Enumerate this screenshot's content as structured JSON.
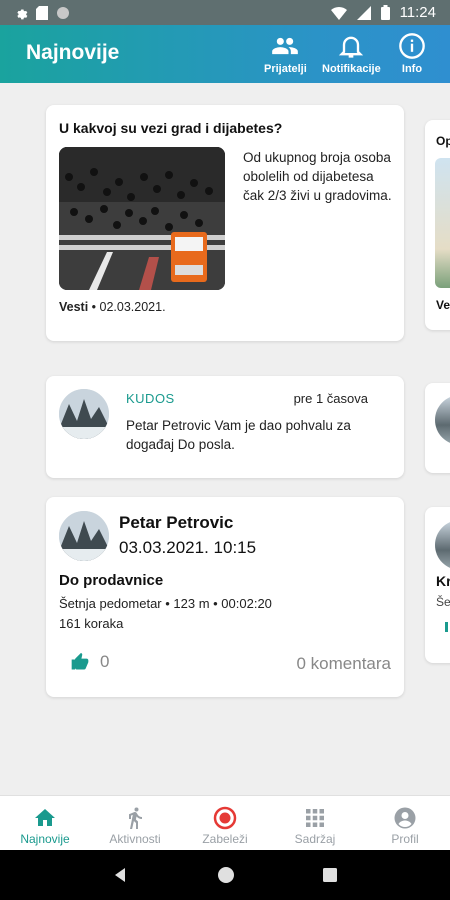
{
  "status_bar": {
    "time": "11:24"
  },
  "app_bar": {
    "title": "Najnovije",
    "actions": [
      {
        "label": "Prijatelji",
        "icon": "friends-icon"
      },
      {
        "label": "Notifikacije",
        "icon": "bell-icon"
      },
      {
        "label": "Info",
        "icon": "info-icon"
      }
    ]
  },
  "feed": {
    "news": {
      "headline": "U kakvoj su vezi grad i dijabetes?",
      "excerpt": "Od ukupnog broja osoba obolelih od dijabetesa čak 2/3 živi u gradovima.",
      "source": "Vesti",
      "date": " • 02.03.2021."
    },
    "kudos": {
      "tag": "KUDOS",
      "time": "pre 1 časova",
      "message": "Petar Petrovic Vam je dao pohvalu za događaj Do posla."
    },
    "activity": {
      "user": "Petar Petrovic",
      "datetime": "03.03.2021. 10:15",
      "title": "Do prodavnice",
      "details": "Šetnja pedometar • 123 m • 00:02:20",
      "steps": "161 koraka",
      "likes": "0",
      "comments": "0 komentara"
    },
    "peek": {
      "card1_title": "Op",
      "card1_meta": "Ve",
      "card3_title": "Kr",
      "card3_meta": "Še"
    }
  },
  "bottom_nav": [
    {
      "label": "Najnovije",
      "icon": "home-icon",
      "active": true
    },
    {
      "label": "Aktivnosti",
      "icon": "walking-icon",
      "active": false
    },
    {
      "label": "Zabeleži",
      "icon": "record-icon",
      "active": false
    },
    {
      "label": "Sadržaj",
      "icon": "grid-icon",
      "active": false
    },
    {
      "label": "Profil",
      "icon": "profile-icon",
      "active": false
    }
  ],
  "colors": {
    "accent": "#1a9a8e",
    "appbar_start": "#1aa39e",
    "appbar_end": "#2f8fd0",
    "record": "#e53935"
  }
}
